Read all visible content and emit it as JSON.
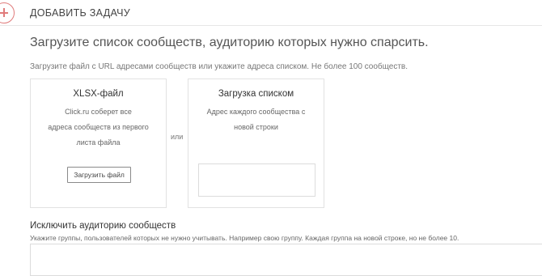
{
  "header": {
    "add_task_label": "ДОБАВИТЬ ЗАДАЧУ",
    "icon": "plus-circle-icon",
    "accent_color": "#e07b7b"
  },
  "main": {
    "heading": "Загрузите список сообществ, аудиторию которых нужно спарсить.",
    "hint": "Загрузите файл с URL адресами сообществ или укажите адреса списком. Не более 100 сообществ.",
    "or_label": "или",
    "xlsx_card": {
      "title": "XLSX-файл",
      "desc_line1": "Click.ru соберет все",
      "desc_line2": "адреса сообществ из первого",
      "desc_line3": "листа файла",
      "button_label": "Загрузить файл"
    },
    "list_card": {
      "title": "Загрузка списком",
      "desc_line1": "Адрес каждого сообщества с",
      "desc_line2": "новой строки",
      "textarea_value": ""
    }
  },
  "exclude": {
    "heading": "Исключить аудиторию сообществ",
    "hint": "Укажите группы, пользователей которых не нужно учитывать. Например свою группу. Каждая группа на новой строке, но не более 10.",
    "textarea_value": ""
  }
}
